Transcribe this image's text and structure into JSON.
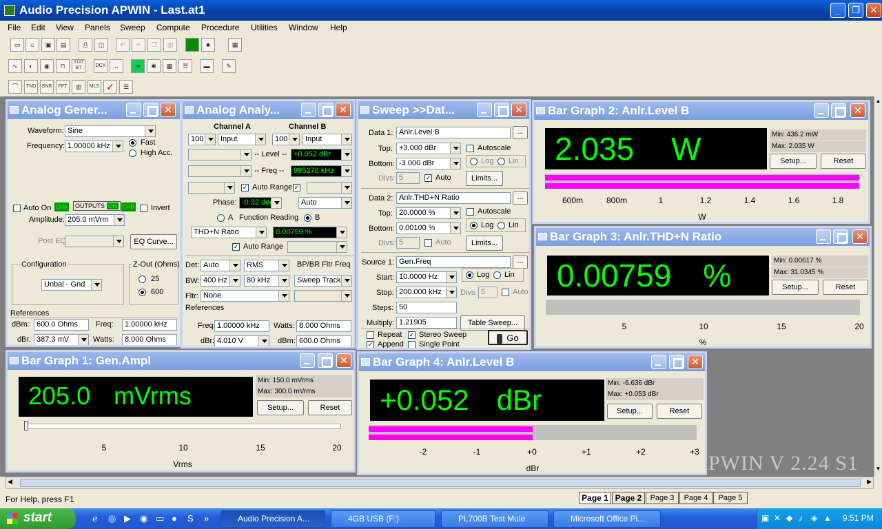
{
  "app": {
    "title": "Audio Precision APWIN - Last.at1",
    "version_watermark": "PWIN V 2.24  S1"
  },
  "menu": [
    "File",
    "Edit",
    "View",
    "Panels",
    "Sweep",
    "Compute",
    "Procedure",
    "Utilities",
    "Window",
    "Help"
  ],
  "toolbar_row3": [
    "TND",
    "SNR",
    "FFT",
    "MLS"
  ],
  "toolbar_row2": [
    "STAT BIT",
    "DCX"
  ],
  "analog_gen": {
    "title": "Analog Gener...",
    "waveform_label": "Waveform:",
    "waveform": "Sine",
    "frequency_label": "Frequency:",
    "frequency": "1.00000 kHz",
    "fast": "Fast",
    "high_acc": "High Acc.",
    "auto_on": "Auto On",
    "cha": "CHA",
    "outputs": "OUTPUTS",
    "on": "ON",
    "chb": "CHB",
    "invert": "Invert",
    "amplitude_label": "Amplitude:",
    "amplitude": "205.0   mVrm",
    "post_eq": "Post EQ",
    "eq_curve": "EQ Curve...",
    "configuration": "Configuration",
    "config_value": "Unbal - Gnd",
    "zout": "Z-Out (Ohms)",
    "z25": "25",
    "z600": "600",
    "references": "References",
    "dbm_label": "dBm:",
    "dbm": "600.0   Ohms",
    "freq_label": "Freq:",
    "freq": "1.00000 kHz",
    "dbr_label": "dBr:",
    "dbr": "387.3   mV",
    "watts_label": "Watts:",
    "watts": "8.000   Ohms"
  },
  "analog_ana": {
    "title": "Analog Analy...",
    "channel_a": "Channel A",
    "channel_b": "Channel B",
    "a_range": "100",
    "a_input": "Input",
    "b_range": "100",
    "b_input": "Input",
    "level_label": "-- Level --",
    "level": "+0.052   dBr",
    "freq_label": "-- Freq --",
    "freq": "995276 kHz",
    "auto_range": "Auto Range",
    "phase_label": "Phase:",
    "phase": "-0.32   deg",
    "phase_mode": "Auto",
    "a": "A",
    "function_reading": "Function Reading",
    "b": "B",
    "function": "THD+N Ratio",
    "function_value": "0.00759  %",
    "det_label": "Det:",
    "det": "Auto",
    "det2": "RMS",
    "bp_br": "BP/BR Fltr Freq",
    "bw_label": "BW:",
    "bw_lo": "400 Hz",
    "bw_hi": "80 kHz",
    "sweep_track": "Sweep Track",
    "fltr_label": "Fltr:",
    "fltr": "None",
    "references": "References",
    "freq_ref_label": "Freq:",
    "freq_ref": "1.00000 kHz",
    "watts_label": "Watts:",
    "watts": "8.000   Ohms",
    "dbr_label": "dBr:",
    "dbr": "4.010   V",
    "dbm_label": "dBm:",
    "dbm": "600.0   Ohms"
  },
  "sweep": {
    "title": "Sweep >>Dat...",
    "data1_label": "Data 1:",
    "data1": "Anlr.Level B",
    "top_label": "Top:",
    "top1": "+3.000   dBr",
    "bottom_label": "Bottom:",
    "bottom1": "-3.000   dBr",
    "autoscale": "Autoscale",
    "log": "Log",
    "lin": "Lin",
    "divs_label": "Divs:",
    "divs1": "5",
    "auto": "Auto",
    "limits": "Limits...",
    "data2_label": "Data 2:",
    "data2": "Anlr.THD+N Ratio",
    "top2": "20.0000  %",
    "bottom2": "0.00100  %",
    "divs2": "5",
    "source1_label": "Source 1:",
    "source1": "Gen.Freq",
    "start_label": "Start:",
    "start": "10.0000  Hz",
    "stop_label": "Stop:",
    "stop": "200.000 kHz",
    "divs3": "5",
    "steps_label": "Steps:",
    "steps": "50",
    "multiply_label": "Multiply:",
    "multiply": "1.21905",
    "table_sweep": "Table Sweep...",
    "repeat": "Repeat",
    "stereo_sweep": "Stereo Sweep",
    "append": "Append",
    "single_point": "Single Point",
    "go": "Go"
  },
  "bar_graph_2": {
    "title": "Bar Graph 2: Anlr.Level B",
    "reading": "2.035",
    "unit": "W",
    "min": "Min: 436.2   mW",
    "max": "Max: 2.035   W",
    "setup": "Setup...",
    "reset": "Reset",
    "ticks": [
      "600m",
      "800m",
      "1",
      "1.2",
      "1.4",
      "1.6",
      "1.8"
    ],
    "axis_unit": "W",
    "fill_fraction": 1.0
  },
  "bar_graph_3": {
    "title": "Bar Graph 3: Anlr.THD+N Ratio",
    "reading": "0.00759",
    "unit": "%",
    "min": "Min: 0.00617  %",
    "max": "Max: 31.0345  %",
    "setup": "Setup...",
    "reset": "Reset",
    "ticks": [
      "5",
      "10",
      "15",
      "20"
    ],
    "axis_unit": "%",
    "fill_fraction": 0.0
  },
  "bar_graph_1": {
    "title": "Bar Graph 1: Gen.Ampl",
    "reading": "205.0",
    "unit": "mVrms",
    "min": "Min: 150.0   mVrms",
    "max": "Max: 300.0   mVrms",
    "setup": "Setup...",
    "reset": "Reset",
    "ticks": [
      "5",
      "10",
      "15",
      "20"
    ],
    "axis_unit": "Vrms",
    "fill_fraction": 0.0
  },
  "bar_graph_4": {
    "title": "Bar Graph 4: Anlr.Level B",
    "reading": "+0.052",
    "unit": "dBr",
    "min": "Min: -6.636   dBr",
    "max": "Max: +0.053   dBr",
    "setup": "Setup...",
    "reset": "Reset",
    "ticks": [
      "-2",
      "-1",
      "+0",
      "+1",
      "+2",
      "+3"
    ],
    "axis_unit": "dBr",
    "fill_fraction": 0.5
  },
  "status": "For Help, press F1",
  "pages": [
    "Page 1",
    "Page 2",
    "Page 3",
    "Page 4",
    "Page 5"
  ],
  "taskbar": {
    "start": "start",
    "tasks": [
      "Audio Precision A...",
      "4GB USB (F:)",
      "PL700B Test Mule",
      "Microsoft Office Pi..."
    ],
    "clock": "9:51 PM"
  },
  "colors": {
    "bar_fill": "#ff00ff",
    "display_text": "#00ff00",
    "title_active": "#0842a8"
  }
}
